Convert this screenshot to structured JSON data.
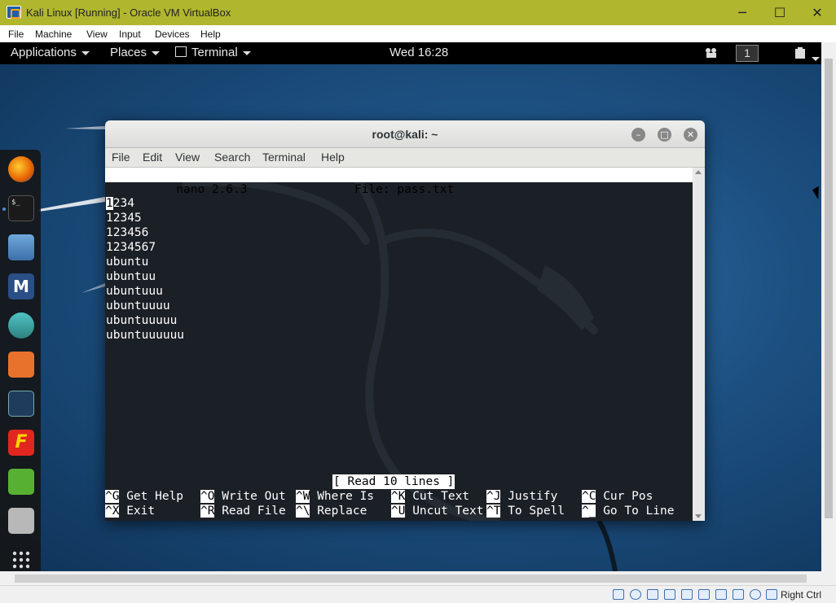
{
  "window": {
    "title": "Kali Linux [Running] - Oracle VM VirtualBox",
    "minimize_glyph": "─",
    "maximize_glyph": "☐",
    "close_glyph": "✕"
  },
  "vbox_menu": [
    "File",
    "Machine",
    "View",
    "Input",
    "Devices",
    "Help"
  ],
  "gnome_topbar": {
    "applications": "Applications",
    "places": "Places",
    "terminal": "Terminal",
    "clock": "Wed 16:28",
    "workspace": "1"
  },
  "dock_icons": [
    "firefox-icon",
    "terminal-icon",
    "files-icon",
    "metasploit-icon",
    "armitage-icon",
    "burpsuite-icon",
    "maltego-icon",
    "faraday-icon",
    "leafpad-icon",
    "cherrytree-icon",
    "show-apps-icon"
  ],
  "terminal": {
    "title": "root@kali: ~",
    "menu": [
      "File",
      "Edit",
      "View",
      "Search",
      "Terminal",
      "Help"
    ]
  },
  "nano": {
    "version": "  nano 2.6.3",
    "file": "File: pass.txt",
    "lines": [
      "1234",
      "12345",
      "123456",
      "1234567",
      "ubuntu",
      "ubuntuu",
      "ubuntuuu",
      "ubuntuuuu",
      "ubuntuuuuu",
      "ubuntuuuuuu"
    ],
    "status": "[ Read 10 lines ]",
    "shortcuts": [
      [
        {
          "key": "^G",
          "label": " Get Help"
        },
        {
          "key": "^O",
          "label": " Write Out"
        },
        {
          "key": "^W",
          "label": " Where Is"
        },
        {
          "key": "^K",
          "label": " Cut Text"
        },
        {
          "key": "^J",
          "label": " Justify"
        },
        {
          "key": "^C",
          "label": " Cur Pos"
        }
      ],
      [
        {
          "key": "^X",
          "label": " Exit"
        },
        {
          "key": "^R",
          "label": " Read File"
        },
        {
          "key": "^\\",
          "label": " Replace"
        },
        {
          "key": "^U",
          "label": " Uncut Text"
        },
        {
          "key": "^T",
          "label": " To Spell"
        },
        {
          "key": "^_",
          "label": " Go To Line"
        }
      ]
    ]
  },
  "statusbar": {
    "host_key": "Right Ctrl"
  },
  "colors": {
    "vbox_titlebar": "#b0b62e",
    "guest_bg": "#1c4f80"
  }
}
